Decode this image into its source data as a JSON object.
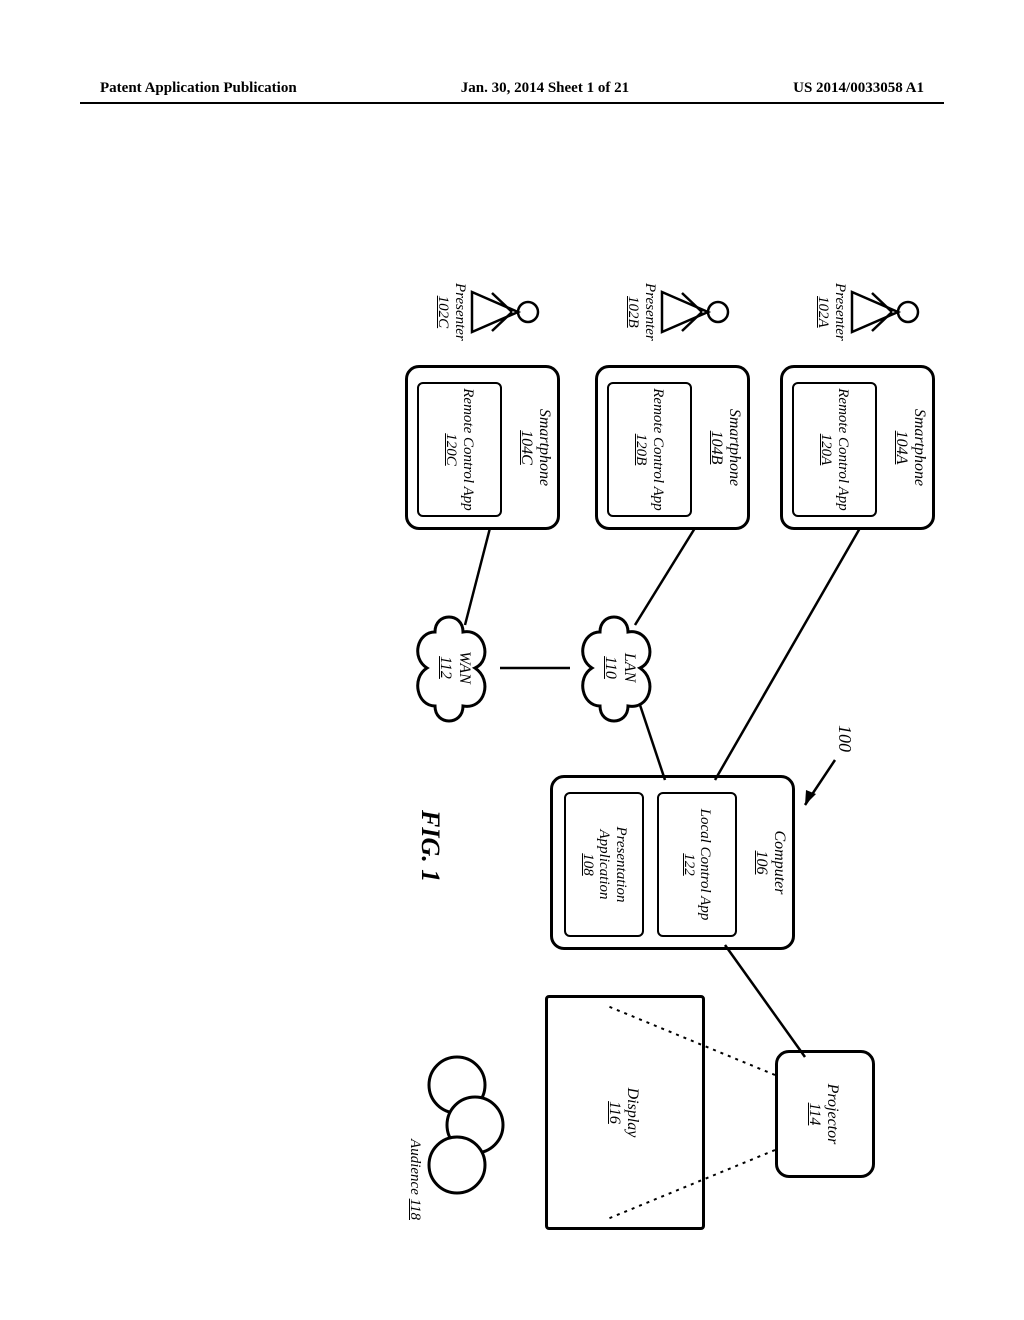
{
  "header": {
    "left": "Patent Application Publication",
    "center": "Jan. 30, 2014  Sheet 1 of 21",
    "right": "US 2014/0033058 A1"
  },
  "system_ref": "100",
  "figure_caption": "FIG. 1",
  "smartphones": [
    {
      "title": "Smartphone",
      "device_id": "104A",
      "app_label": "Remote Control App",
      "app_id": "120A"
    },
    {
      "title": "Smartphone",
      "device_id": "104B",
      "app_label": "Remote Control App",
      "app_id": "120B"
    },
    {
      "title": "Smartphone",
      "device_id": "104C",
      "app_label": "Remote Control App",
      "app_id": "120C"
    }
  ],
  "presenters": [
    {
      "label": "Presenter",
      "id": "102A"
    },
    {
      "label": "Presenter",
      "id": "102B"
    },
    {
      "label": "Presenter",
      "id": "102C"
    }
  ],
  "networks": {
    "lan": {
      "label": "LAN",
      "id": "110"
    },
    "wan": {
      "label": "WAN",
      "id": "112"
    }
  },
  "computer": {
    "title": "Computer",
    "id": "106",
    "local_app": {
      "label": "Local Control App",
      "id": "122"
    },
    "pres_app": {
      "label": "Presentation Application",
      "id": "108"
    }
  },
  "projector": {
    "title": "Projector",
    "id": "114"
  },
  "display": {
    "title": "Display",
    "id": "116"
  },
  "audience": {
    "label": "Audience",
    "id": "118"
  },
  "chart_data": {
    "type": "diagram",
    "title": "FIG. 1 — Presentation system architecture (ref 100)",
    "nodes": [
      {
        "id": "102A",
        "label": "Presenter",
        "type": "actor"
      },
      {
        "id": "102B",
        "label": "Presenter",
        "type": "actor"
      },
      {
        "id": "102C",
        "label": "Presenter",
        "type": "actor"
      },
      {
        "id": "104A",
        "label": "Smartphone",
        "type": "device",
        "contains": [
          "120A"
        ]
      },
      {
        "id": "104B",
        "label": "Smartphone",
        "type": "device",
        "contains": [
          "120B"
        ]
      },
      {
        "id": "104C",
        "label": "Smartphone",
        "type": "device",
        "contains": [
          "120C"
        ]
      },
      {
        "id": "120A",
        "label": "Remote Control App",
        "type": "app"
      },
      {
        "id": "120B",
        "label": "Remote Control App",
        "type": "app"
      },
      {
        "id": "120C",
        "label": "Remote Control App",
        "type": "app"
      },
      {
        "id": "110",
        "label": "LAN",
        "type": "network"
      },
      {
        "id": "112",
        "label": "WAN",
        "type": "network"
      },
      {
        "id": "106",
        "label": "Computer",
        "type": "device",
        "contains": [
          "122",
          "108"
        ]
      },
      {
        "id": "122",
        "label": "Local Control App",
        "type": "app"
      },
      {
        "id": "108",
        "label": "Presentation Application",
        "type": "app"
      },
      {
        "id": "114",
        "label": "Projector",
        "type": "device"
      },
      {
        "id": "116",
        "label": "Display",
        "type": "surface"
      },
      {
        "id": "118",
        "label": "Audience",
        "type": "actor-group"
      }
    ],
    "edges": [
      {
        "from": "102A",
        "to": "104A",
        "kind": "uses"
      },
      {
        "from": "102B",
        "to": "104B",
        "kind": "uses"
      },
      {
        "from": "102C",
        "to": "104C",
        "kind": "uses"
      },
      {
        "from": "104A",
        "to": "106",
        "kind": "direct-connection"
      },
      {
        "from": "104B",
        "to": "110",
        "kind": "network"
      },
      {
        "from": "104C",
        "to": "112",
        "kind": "network"
      },
      {
        "from": "112",
        "to": "110",
        "kind": "network"
      },
      {
        "from": "110",
        "to": "106",
        "kind": "network"
      },
      {
        "from": "106",
        "to": "114",
        "kind": "video-out"
      },
      {
        "from": "114",
        "to": "116",
        "kind": "projection",
        "style": "dotted"
      },
      {
        "from": "116",
        "to": "118",
        "kind": "viewed-by"
      }
    ]
  }
}
